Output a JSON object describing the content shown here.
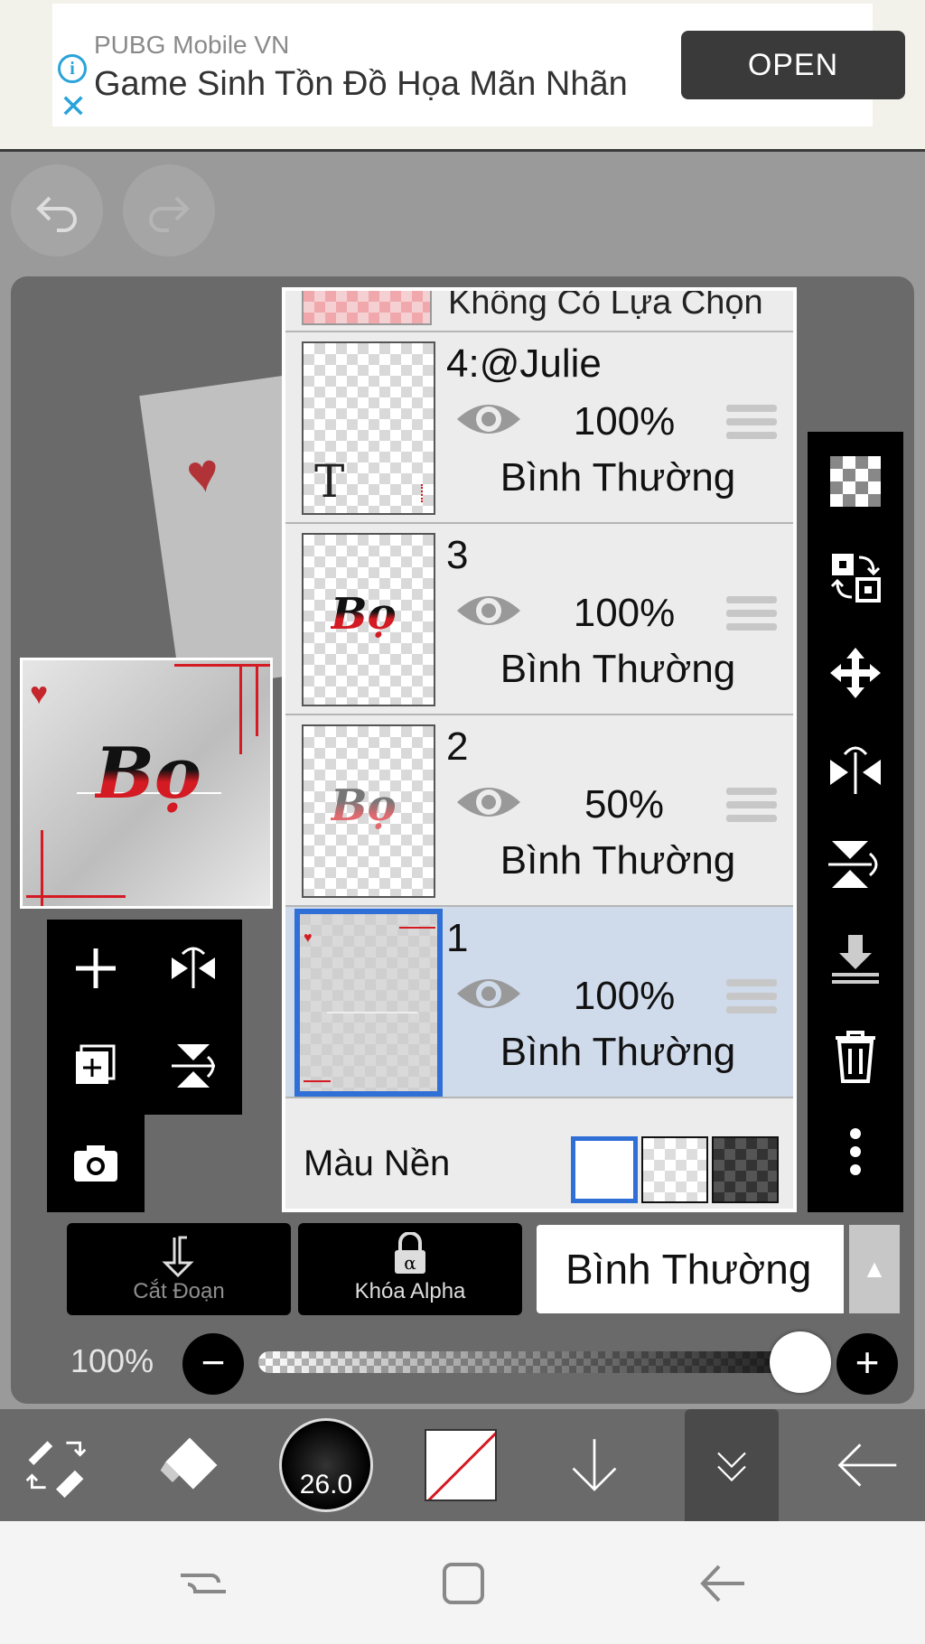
{
  "ad": {
    "source": "PUBG Mobile VN",
    "headline": "Game Sinh Tồn Đồ Họa Mãn Nhãn",
    "open_label": "OPEN",
    "info_icon": "info-icon",
    "close_icon": "close-icon"
  },
  "history": {
    "undo_icon": "undo-icon",
    "redo_icon": "redo-icon"
  },
  "canvas": {
    "preview_text": "Bọ"
  },
  "layers": {
    "top_row_label": "Không Có Lựa Chọn",
    "items": [
      {
        "name": "4:@Julie",
        "opacity": "100%",
        "blend": "Bình Thường",
        "thumb_glyph": "T",
        "selected": false
      },
      {
        "name": "3",
        "opacity": "100%",
        "blend": "Bình Thường",
        "thumb_glyph": "Bọ",
        "selected": false
      },
      {
        "name": "2",
        "opacity": "50%",
        "blend": "Bình Thường",
        "thumb_glyph": "Bọ",
        "selected": false
      },
      {
        "name": "1",
        "opacity": "100%",
        "blend": "Bình Thường",
        "thumb_glyph": "",
        "selected": true
      }
    ],
    "background_label": "Màu Nền"
  },
  "actions": {
    "clip_label": "Cắt Đoạn",
    "alpha_lock_label": "Khóa Alpha",
    "alpha_symbol": "α",
    "blend_mode": "Bình Thường",
    "blend_arrow": "▲"
  },
  "opacity_slider": {
    "label": "100%",
    "minus": "−",
    "plus": "+",
    "value_fraction": 1.0
  },
  "bottom_toolbar": {
    "brush_size": "26.0"
  },
  "colors": {
    "accent_blue": "#2f6fd6",
    "brand_red": "#d41a22",
    "selected_row": "#cfdaeb"
  }
}
